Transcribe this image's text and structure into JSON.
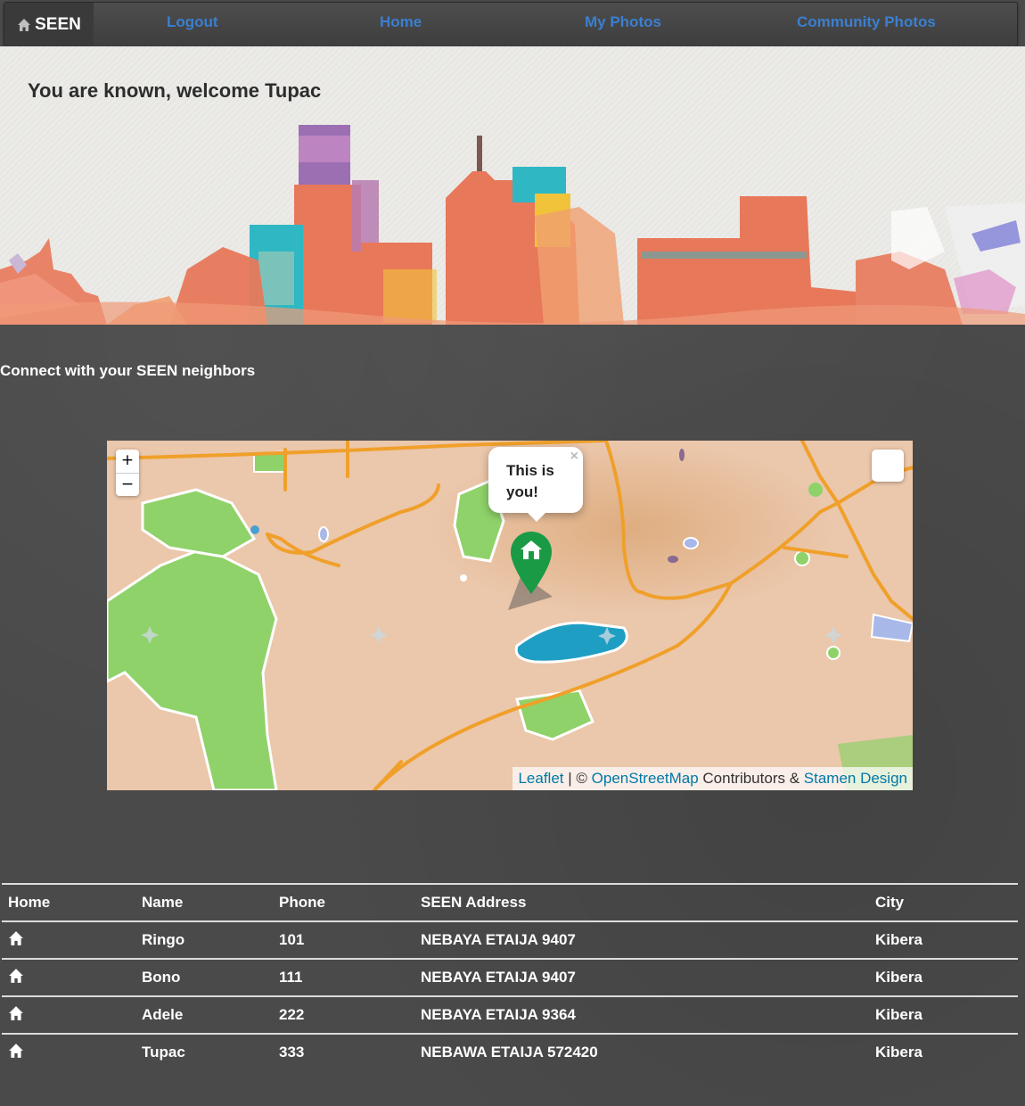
{
  "navbar": {
    "brand": "SEEN",
    "links": [
      "Logout",
      "Home",
      "My Photos",
      "Community Photos"
    ]
  },
  "hero": {
    "welcome": "You are known, welcome Tupac"
  },
  "section": {
    "subtitle": "Connect with your SEEN neighbors"
  },
  "map": {
    "zoom_in": "+",
    "zoom_out": "−",
    "popup_text": "This is you!",
    "popup_close": "×",
    "marker_icon": "home-icon",
    "attribution": {
      "leaflet": "Leaflet",
      "sep": " | © ",
      "osm": "OpenStreetMap",
      "contrib": " Contributors & ",
      "stamen": "Stamen Design"
    }
  },
  "table": {
    "headers": [
      "Home",
      "Name",
      "Phone",
      "SEEN Address",
      "City"
    ],
    "rows": [
      {
        "name": "Ringo",
        "phone": "101",
        "address": "NEBAYA ETAIJA 9407",
        "city": "Kibera"
      },
      {
        "name": "Bono",
        "phone": "111",
        "address": "NEBAYA ETAIJA 9407",
        "city": "Kibera"
      },
      {
        "name": "Adele",
        "phone": "222",
        "address": "NEBAYA ETAIJA 9364",
        "city": "Kibera"
      },
      {
        "name": "Tupac",
        "phone": "333",
        "address": "NEBAWA ETAIJA 572420",
        "city": "Kibera"
      }
    ]
  }
}
